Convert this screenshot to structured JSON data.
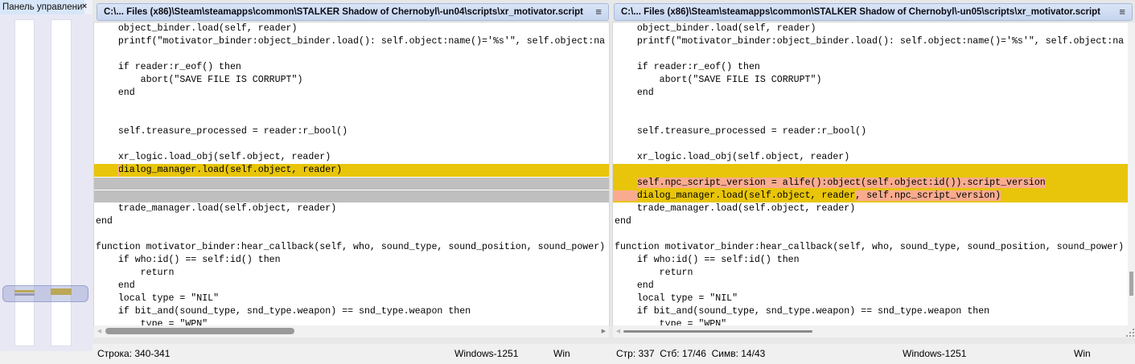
{
  "colors": {
    "diff-yellow": "#e8c50a",
    "word-salmon": "#f9ab8f",
    "ghost-gray": "#bfbfbf",
    "marker-gold": "#d8b000",
    "marker-gray": "#9a9aa5",
    "caption-bg": "#d7e6f9",
    "loc-bg": "#e8e8f4",
    "header-border": "#a8b8d8"
  },
  "location_pane": {
    "title": "Панель управлени",
    "close_label": "×"
  },
  "panes": {
    "left": {
      "path": "C:\\... Files (x86)\\Steam\\steamapps\\common\\STALKER Shadow of Chernobyl\\-un04\\scripts\\xr_motivator.script",
      "menu_icon": "≡",
      "status": {
        "position": "Строка: 340-341",
        "encoding": "Windows-1251",
        "eol": "Win"
      },
      "lines": [
        {
          "t": "    object_binder.load(self, reader)"
        },
        {
          "t": "    printf(\"motivator_binder:object_binder.load(): self.object:name()='%s'\", self.object:na"
        },
        {
          "t": ""
        },
        {
          "t": "    if reader:r_eof() then"
        },
        {
          "t": "        abort(\"SAVE FILE IS CORRUPT\")"
        },
        {
          "t": "    end"
        },
        {
          "t": ""
        },
        {
          "t": ""
        },
        {
          "t": "    self.treasure_processed = reader:r_bool()"
        },
        {
          "t": ""
        },
        {
          "t": "    xr_logic.load_obj(self.object, reader)"
        },
        {
          "t": "    dialog_manager.load(self.object, reader)",
          "bg": "diff",
          "marker": true
        },
        {
          "ghost": true
        },
        {
          "ghost": true
        },
        {
          "t": "    trade_manager.load(self.object, reader)"
        },
        {
          "t": "end"
        },
        {
          "t": ""
        },
        {
          "t": "function motivator_binder:hear_callback(self, who, sound_type, sound_position, sound_power)"
        },
        {
          "t": "    if who:id() == self:id() then"
        },
        {
          "t": "        return"
        },
        {
          "t": "    end"
        },
        {
          "t": "    local type = \"NIL\""
        },
        {
          "t": "    if bit_and(sound_type, snd_type.weapon) == snd_type.weapon then"
        },
        {
          "t": "        type = \"WPN\""
        }
      ]
    },
    "right": {
      "path": "C:\\... Files (x86)\\Steam\\steamapps\\common\\STALKER Shadow of Chernobyl\\-un05\\scripts\\xr_motivator.script",
      "menu_icon": "≡",
      "status": {
        "position": "Стр: 337  Стб: 17/46  Симв: 14/43",
        "encoding": "Windows-1251",
        "eol": "Win"
      },
      "lines": [
        {
          "t": "    object_binder.load(self, reader)"
        },
        {
          "t": "    printf(\"motivator_binder:object_binder.load(): self.object:name()='%s'\", self.object:na"
        },
        {
          "t": ""
        },
        {
          "t": "    if reader:r_eof() then"
        },
        {
          "t": "        abort(\"SAVE FILE IS CORRUPT\")"
        },
        {
          "t": "    end"
        },
        {
          "t": ""
        },
        {
          "t": ""
        },
        {
          "t": "    self.treasure_processed = reader:r_bool()"
        },
        {
          "t": ""
        },
        {
          "t": "    xr_logic.load_obj(self.object, reader)"
        },
        {
          "t": "",
          "bg": "diff"
        },
        {
          "bg": "diff",
          "segs": [
            {
              "t": "    "
            },
            {
              "t": "self.npc_script_version = alife():object(self.object:id()).script_version",
              "w": true
            }
          ]
        },
        {
          "bg": "diff",
          "segs": [
            {
              "t": "    ",
              "w": true,
              "mfill": true
            },
            {
              "t": "dialog_manager.load(self.object, reader"
            },
            {
              "t": ", self.npc_script_version)",
              "w": true
            }
          ]
        },
        {
          "t": "    trade_manager.load(self.object, reader)"
        },
        {
          "t": "end"
        },
        {
          "t": ""
        },
        {
          "t": "function motivator_binder:hear_callback(self, who, sound_type, sound_position, sound_power)"
        },
        {
          "t": "    if who:id() == self:id() then"
        },
        {
          "t": "        return"
        },
        {
          "t": "    end"
        },
        {
          "t": "    local type = \"NIL\""
        },
        {
          "t": "    if bit_and(sound_type, snd_type.weapon) == snd_type.weapon then"
        },
        {
          "t": "        type = \"WPN\""
        }
      ]
    }
  },
  "scrollbar": {
    "left_arrow_icon": "◀",
    "right_arrow_icon": "▶"
  }
}
